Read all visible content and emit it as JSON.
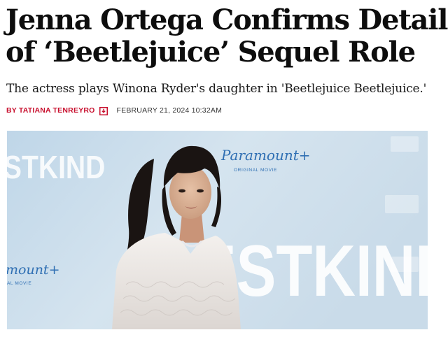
{
  "article": {
    "headline": "Jenna Ortega Confirms Details of ‘Beetlejuice’ Sequel Role",
    "dek": "The actress plays Winona Ryder's daughter in 'Beetlejuice Beetlejuice.'",
    "byline": "By Tatiana Tenreyro",
    "date": "February 21, 2024 10:32AM"
  },
  "hero_image": {
    "backdrop": {
      "left_text": "STKIND",
      "center_text": "ESTKIND",
      "logo_top": "Paramount+",
      "logo_top_sub": "ORIGINAL MOVIE",
      "logo_left": "mount+",
      "logo_left_sub": "AL MOVIE"
    }
  },
  "icons": {
    "author_contact": "mail-icon"
  },
  "colors": {
    "byline": "#c8102e",
    "headline": "#0d0d0d",
    "backdrop": "#cfdfec"
  }
}
